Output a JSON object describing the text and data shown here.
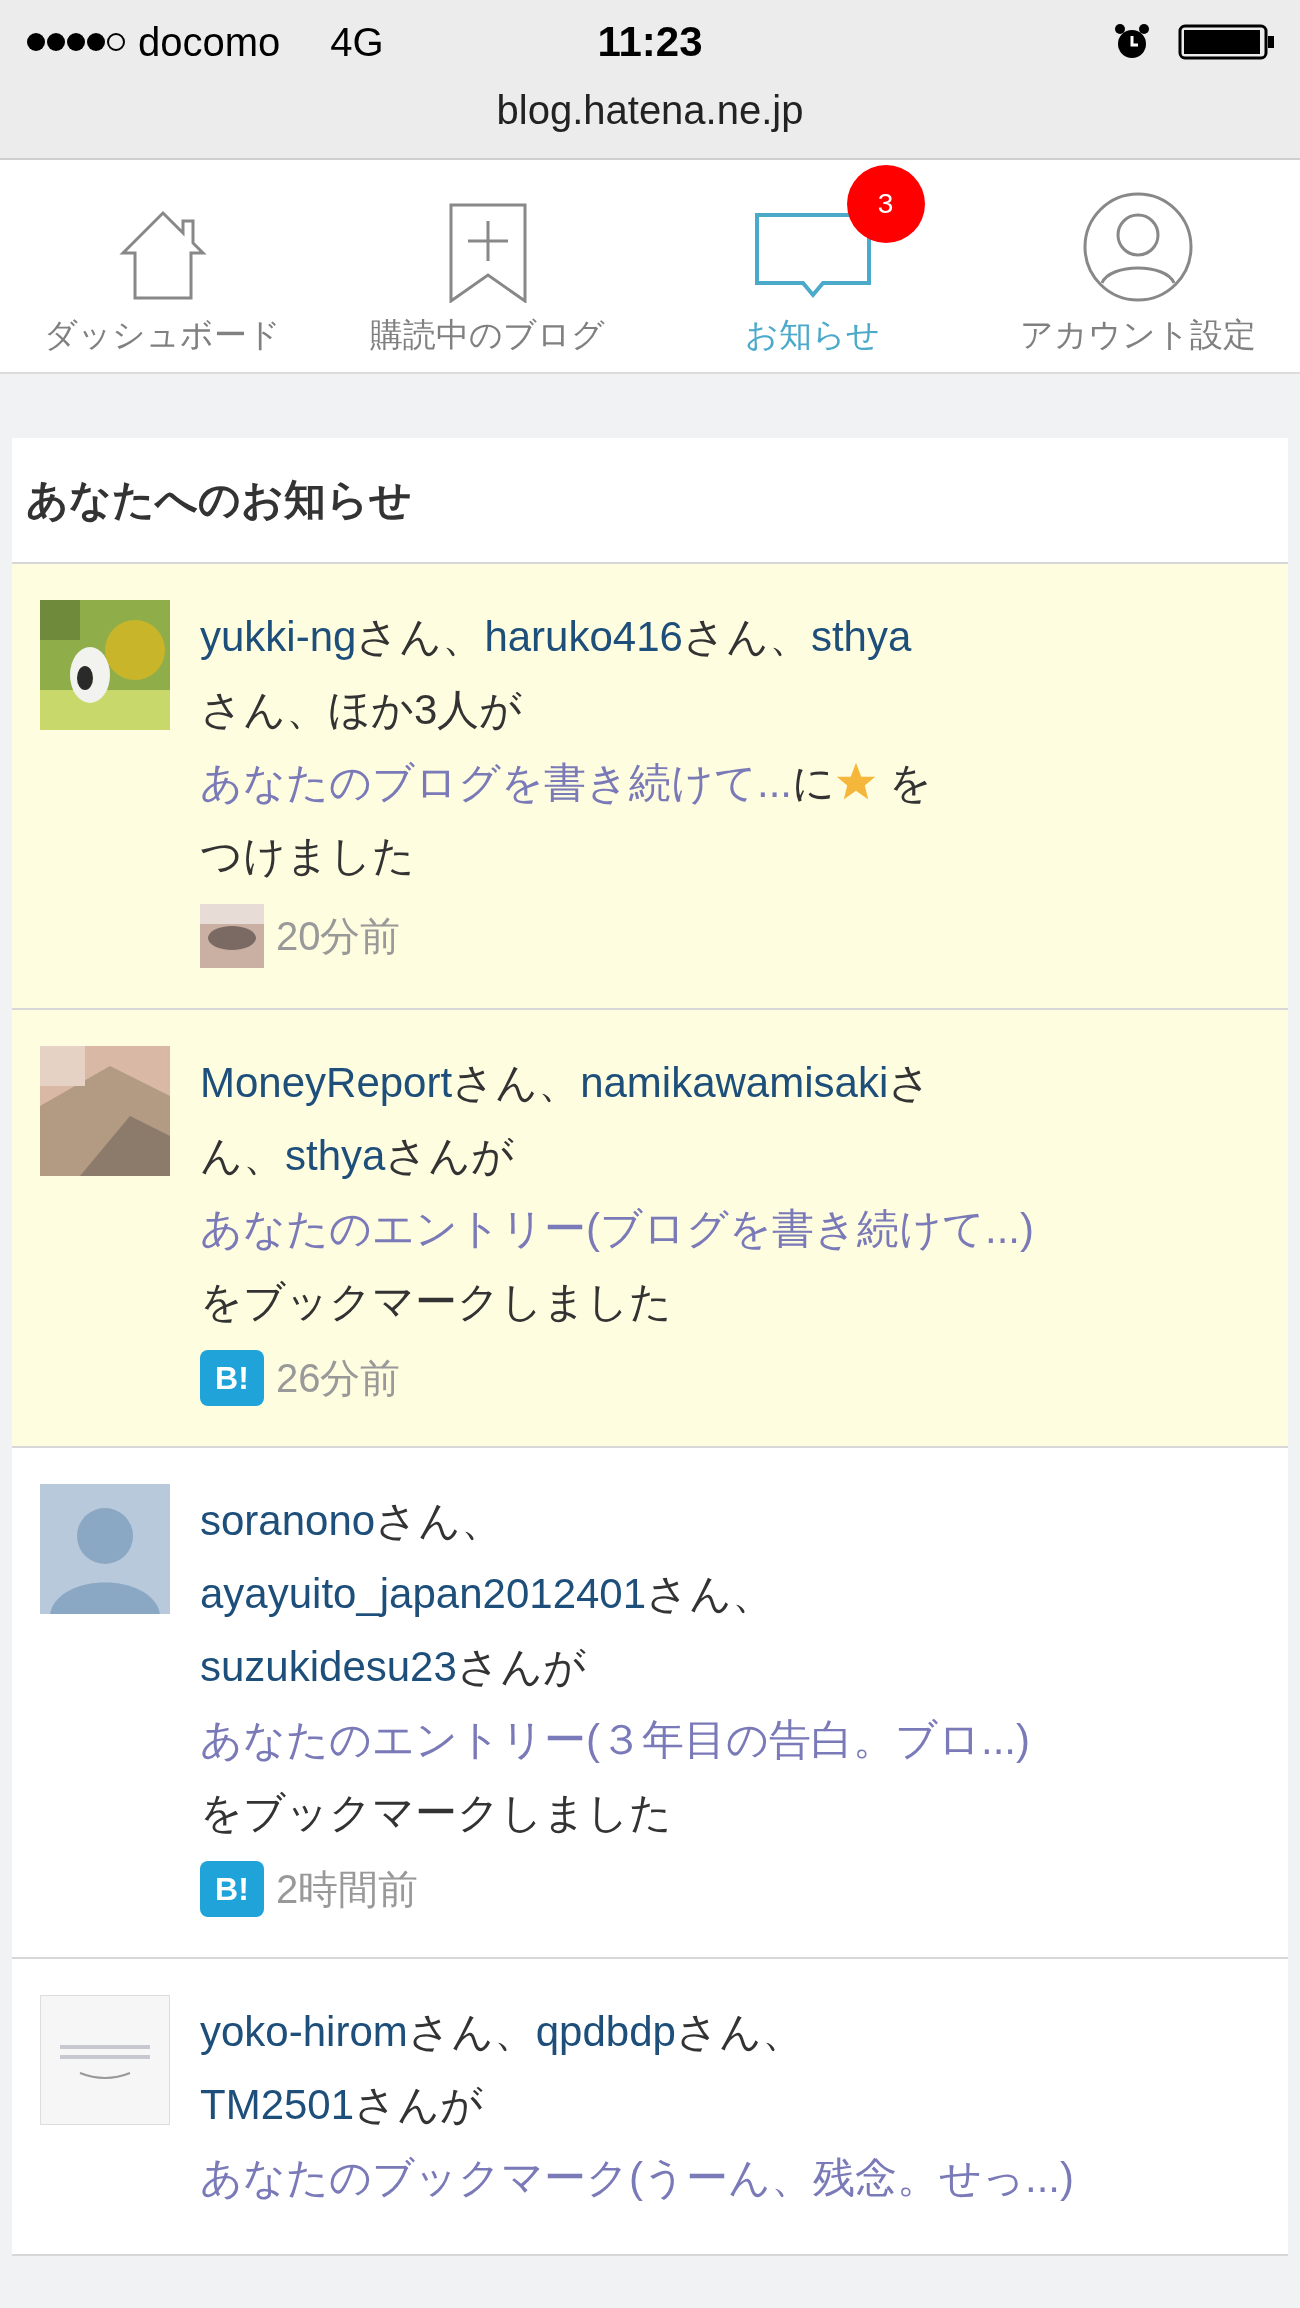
{
  "status_bar": {
    "carrier": "docomo",
    "network": "4G",
    "time": "11:23",
    "url": "blog.hatena.ne.jp"
  },
  "tabs": [
    {
      "kind": "home",
      "label": "ダッシュボード",
      "selected": false
    },
    {
      "kind": "bookmark",
      "label": "購読中のブログ",
      "selected": false
    },
    {
      "kind": "speech",
      "label": "お知らせ",
      "selected": true,
      "badge": "3"
    },
    {
      "kind": "account",
      "label": "アカウント設定",
      "selected": false
    }
  ],
  "notifications": {
    "title": "あなたへのお知らせ",
    "items": [
      {
        "unread": true,
        "avatar": {
          "kind": "picture"
        },
        "message": [
          {
            "kind": "user",
            "text": "yukki-ng"
          },
          {
            "kind": "text",
            "text": "さん、"
          },
          {
            "kind": "user",
            "text": "haruko416"
          },
          {
            "kind": "text",
            "text": "さん、"
          },
          {
            "kind": "user",
            "text": "sthya"
          },
          {
            "kind": "text",
            "text": "さん、ほか3人が"
          },
          {
            "kind": "entry",
            "text": "あなたのブログを書き続けて..."
          },
          {
            "kind": "text",
            "text": "に"
          },
          {
            "kind": "star"
          },
          {
            "kind": "text",
            "text": " をつけました"
          }
        ],
        "footer": {
          "kind": "picture",
          "time": "20分前"
        }
      },
      {
        "unread": true,
        "avatar": {
          "kind": "picture"
        },
        "message": [
          {
            "kind": "user",
            "text": "MoneyReport"
          },
          {
            "kind": "text",
            "text": "さん、"
          },
          {
            "kind": "user",
            "text": "namikawamisaki"
          },
          {
            "kind": "text",
            "text": "さん、"
          },
          {
            "kind": "user",
            "text": "sthya"
          },
          {
            "kind": "text",
            "text": "さんが"
          },
          {
            "kind": "entry",
            "text": "あなたのエントリー(ブログを書き続けて...)"
          },
          {
            "kind": "text",
            "text": "をブックマークしました"
          }
        ],
        "footer": {
          "kind": "bookmark",
          "label": "B!",
          "time": "26分前"
        }
      },
      {
        "unread": false,
        "avatar": {
          "kind": "silhouette"
        },
        "message": [
          {
            "kind": "user",
            "text": "soranono"
          },
          {
            "kind": "text",
            "text": "さん、"
          },
          {
            "kind": "user",
            "text": "ayayuito_japan2012401"
          },
          {
            "kind": "text",
            "text": "さん、"
          },
          {
            "kind": "user",
            "text": "suzukidesu23"
          },
          {
            "kind": "text",
            "text": "さんが"
          },
          {
            "kind": "entry",
            "text": "あなたのエントリー(３年目の告白。ブロ...)"
          },
          {
            "kind": "text",
            "text": "をブックマークしました"
          }
        ],
        "footer": {
          "kind": "bookmark",
          "label": "B!",
          "time": "2時間前"
        }
      },
      {
        "unread": false,
        "avatar": {
          "kind": "picture"
        },
        "message": [
          {
            "kind": "user",
            "text": "yoko-hirom"
          },
          {
            "kind": "text",
            "text": "さん、"
          },
          {
            "kind": "user",
            "text": "qpdbdp"
          },
          {
            "kind": "text",
            "text": "さん、"
          },
          {
            "kind": "user",
            "text": "TM2501"
          },
          {
            "kind": "text",
            "text": "さんが"
          },
          {
            "kind": "entry",
            "text": "あなたのブックマーク(うーん、残念。せっ...)"
          }
        ]
      }
    ]
  }
}
